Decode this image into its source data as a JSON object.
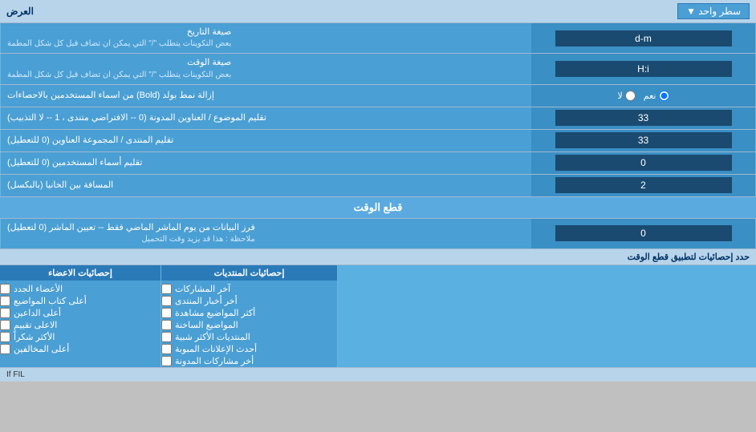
{
  "title": "العرض",
  "dropdown_label": "سطر واحد",
  "rows": [
    {
      "id": "date_format",
      "label": "صيغة التاريخ",
      "sublabel": "بعض التكوينات يتطلب \"/\" التي يمكن ان تضاف قبل كل شكل المطمة",
      "value": "d-m",
      "type": "text"
    },
    {
      "id": "time_format",
      "label": "صيغة الوقت",
      "sublabel": "بعض التكوينات يتطلب \"/\" التي يمكن ان تضاف قبل كل شكل المطمة",
      "value": "H:i",
      "type": "text"
    },
    {
      "id": "bold_remove",
      "label": "إزالة نمط بولد (Bold) من اسماء المستخدمين بالاحصاءات",
      "sublabel": "",
      "value": "",
      "type": "radio",
      "radio_options": [
        "نعم",
        "لا"
      ],
      "radio_selected": 1
    },
    {
      "id": "subject_title",
      "label": "تقليم الموضوع / العناوين المدونة (0 -- الافتراضي متندى ، 1 -- لا التذبيب)",
      "sublabel": "",
      "value": "33",
      "type": "text"
    },
    {
      "id": "forum_title",
      "label": "تقليم المنتدى / المجموعة العناوين (0 للتعطيل)",
      "sublabel": "",
      "value": "33",
      "type": "text"
    },
    {
      "id": "username_trim",
      "label": "تقليم أسماء المستخدمين (0 للتعطيل)",
      "sublabel": "",
      "value": "0",
      "type": "text"
    },
    {
      "id": "col_spacing",
      "label": "المسافة بين الخانيا (بالبكسل)",
      "sublabel": "",
      "value": "2",
      "type": "text"
    }
  ],
  "section_time_cut": "قطع الوقت",
  "row_time_cut": {
    "label": "فرز البيانات من يوم الماشر الماضي فقط -- تعيين الماشر (0 لتعطيل)",
    "sublabel": "ملاحظة : هذا قد يزيد وقت التحميل",
    "value": "0"
  },
  "stats_limit_label": "حدد إحصائيات لتطبيق قطع الوقت",
  "col1_header": "إحصائيات المنتديات",
  "col2_header": "إحصائيات الاعضاء",
  "col1_items": [
    "آخر المشاركات",
    "أخر أخبار المنتدى",
    "أكثر المواضيع مشاهدة",
    "المواضيع الساخنة",
    "المنتديات الأكثر شبية",
    "أحدث الإعلانات المبوبة",
    "أخر مشاركات المدونة"
  ],
  "col2_items": [
    "الأعضاء الجدد",
    "أعلى كتاب المواضيع",
    "أعلى الداعين",
    "الاعلى تقييم",
    "الأكثر شكراً",
    "أعلى المخالفين"
  ],
  "col3_header": "",
  "note_text": "If FIL"
}
